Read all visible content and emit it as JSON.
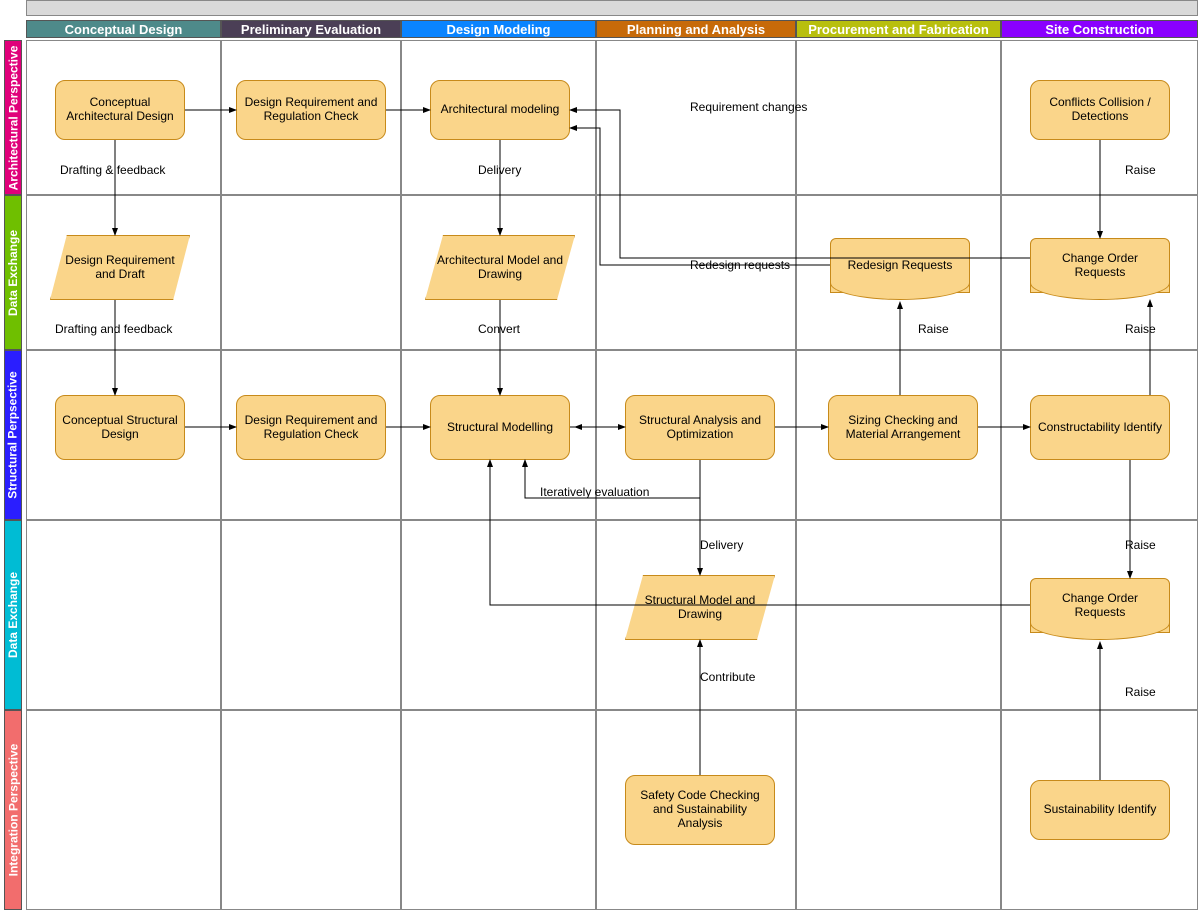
{
  "columns": [
    {
      "label": "Conceptual Design",
      "color": "#4e8a8a"
    },
    {
      "label": "Preliminary Evaluation",
      "color": "#4b3f56"
    },
    {
      "label": "Design Modeling",
      "color": "#0a84ff"
    },
    {
      "label": "Planning and Analysis",
      "color": "#c76a09"
    },
    {
      "label": "Procurement and Fabrication",
      "color": "#b8bf0e"
    },
    {
      "label": "Site Construction",
      "color": "#8a00ff"
    }
  ],
  "rows": [
    {
      "label": "Architectural Perspective",
      "color": "#e0007a"
    },
    {
      "label": "Data Exchange",
      "color": "#6fbf00"
    },
    {
      "label": "Structural Perpsective",
      "color": "#2a1eff"
    },
    {
      "label": "Data Exchange",
      "color": "#00bcd4"
    },
    {
      "label": "Integration Perspective",
      "color": "#f26d6d"
    }
  ],
  "nodes": {
    "n_conc_arch": "Conceptual Architectural Design",
    "n_req_check_a": "Design Requirement and Regulation Check",
    "n_arch_model": "Architectural modeling",
    "n_conflicts": "Conflicts Collision / Detections",
    "n_design_req_draft": "Design Requirement and Draft",
    "n_arch_model_draw": "Architectural Model and Drawing",
    "n_redesign_req": "Redesign Requests",
    "n_change_order_a": "Change Order Requests",
    "n_conc_struct": "Conceptual Structural Design",
    "n_req_check_s": "Design Requirement and Regulation Check",
    "n_struct_model": "Structural Modelling",
    "n_struct_anal": "Structural Analysis and Optimization",
    "n_sizing": "Sizing Checking and Material Arrangement",
    "n_construct": "Constructability Identify",
    "n_struct_model_draw": "Structural Model and Drawing",
    "n_change_order_b": "Change Order Requests",
    "n_safety": "Safety Code Checking and Sustainability Analysis",
    "n_sustain": "Sustainability Identify"
  },
  "labels": {
    "l_draft_fb": "Drafting & feedback",
    "l_delivery_a": "Delivery",
    "l_raise1": "Raise",
    "l_req_changes": "Requirement changes",
    "l_redesign_req": "Redesign requests",
    "l_draft_fb2": "Drafting and feedback",
    "l_convert": "Convert",
    "l_raise2": "Raise",
    "l_raise3": "Raise",
    "l_iter_eval": "Iteratively evaluation",
    "l_delivery_b": "Delivery",
    "l_raise4": "Raise",
    "l_contribute": "Contribute",
    "l_raise5": "Raise"
  },
  "diagram": {
    "type": "cross-functional-flowchart",
    "swimlane_rows": 5,
    "swimlane_cols": 6,
    "edges": [
      {
        "from": "n_conc_arch",
        "to": "n_req_check_a"
      },
      {
        "from": "n_req_check_a",
        "to": "n_arch_model"
      },
      {
        "from": "n_conc_arch",
        "to": "n_design_req_draft",
        "label": "Drafting & feedback"
      },
      {
        "from": "n_arch_model",
        "to": "n_arch_model_draw",
        "label": "Delivery"
      },
      {
        "from": "n_conflicts",
        "to": "n_change_order_a",
        "label": "Raise"
      },
      {
        "from": "n_design_req_draft",
        "to": "n_conc_struct",
        "label": "Drafting and feedback"
      },
      {
        "from": "n_arch_model_draw",
        "to": "n_struct_model",
        "label": "Convert"
      },
      {
        "from": "n_conc_struct",
        "to": "n_req_check_s"
      },
      {
        "from": "n_req_check_s",
        "to": "n_struct_model"
      },
      {
        "from": "n_struct_model",
        "to": "n_struct_anal",
        "bidir": true
      },
      {
        "from": "n_struct_anal",
        "to": "n_sizing"
      },
      {
        "from": "n_sizing",
        "to": "n_construct"
      },
      {
        "from": "n_sizing",
        "to": "n_redesign_req",
        "label": "Raise"
      },
      {
        "from": "n_redesign_req",
        "to": "n_arch_model",
        "label": "Redesign requests",
        "routed": true
      },
      {
        "from": "n_struct_anal",
        "to": "n_struct_model",
        "label": "Iteratively evaluation",
        "routed": true
      },
      {
        "from": "n_struct_anal",
        "to": "n_struct_model_draw",
        "label": "Delivery"
      },
      {
        "from": "n_safety",
        "to": "n_struct_model_draw",
        "label": "Contribute"
      },
      {
        "from": "n_construct",
        "to": "n_change_order_a",
        "label": "Raise",
        "routed": true
      },
      {
        "from": "n_construct",
        "to": "n_change_order_b",
        "label": "Raise",
        "routed": true
      },
      {
        "from": "n_sustain",
        "to": "n_change_order_b",
        "label": "Raise"
      },
      {
        "from": "n_change_order_a",
        "to": "n_arch_model",
        "label": "Requirement changes",
        "routed": true
      },
      {
        "from": "n_change_order_b",
        "to": "n_struct_model",
        "routed": true
      }
    ]
  }
}
